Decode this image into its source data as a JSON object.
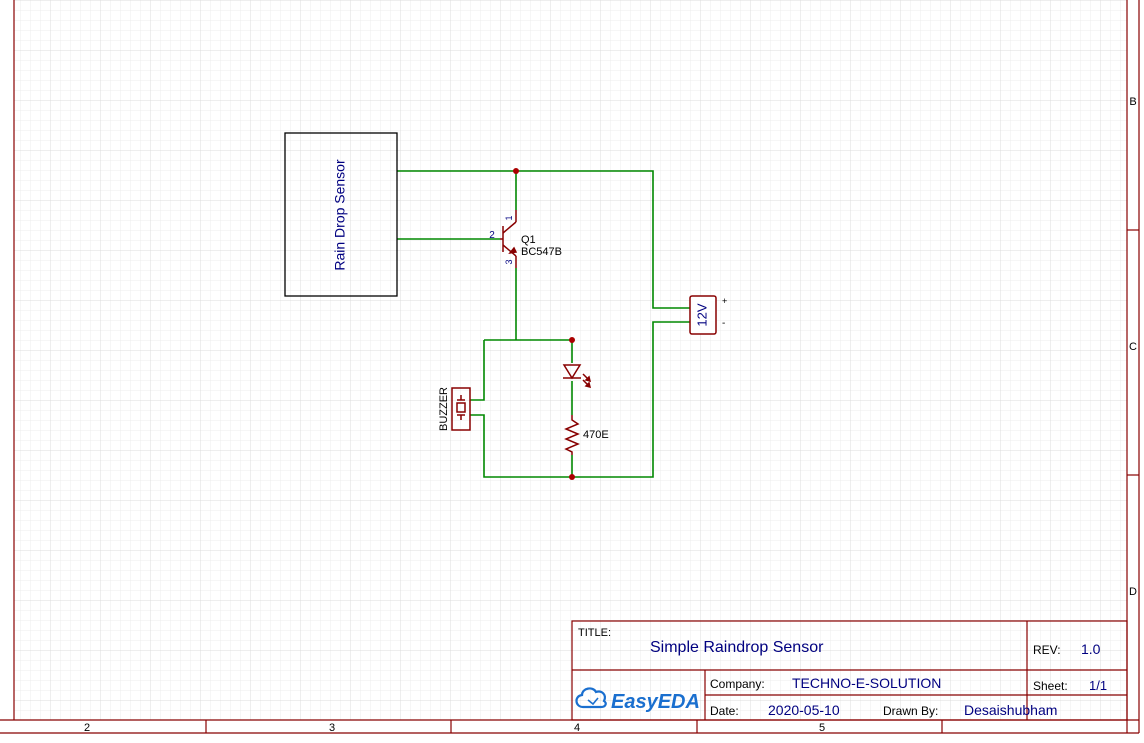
{
  "border": {
    "rows": [
      "B",
      "C",
      "D"
    ],
    "columns": [
      "2",
      "3",
      "4",
      "5"
    ]
  },
  "components": {
    "sensor": {
      "label": "Rain Drop Sensor"
    },
    "transistor": {
      "ref": "Q1",
      "value": "BC547B",
      "pins": {
        "collector": "1",
        "base": "2",
        "emitter": "3"
      }
    },
    "supply": {
      "label": "12V",
      "plus": "+",
      "minus": "-"
    },
    "buzzer": {
      "label": "BUZZER"
    },
    "resistor": {
      "value": "470E"
    }
  },
  "title_block": {
    "title_label": "TITLE:",
    "title": "Simple Raindrop Sensor",
    "rev_label": "REV:",
    "rev": "1.0",
    "logo_text": "EasyEDA",
    "company_label": "Company:",
    "company": "TECHNO-E-SOLUTION",
    "sheet_label": "Sheet:",
    "sheet": "1/1",
    "date_label": "Date:",
    "date": "2020-05-10",
    "drawn_by_label": "Drawn By:",
    "drawn_by": "Desaishubham"
  },
  "colors": {
    "wire": "#008800",
    "component": "#880000",
    "text": "#000080",
    "frame": "#880000",
    "grid": "#e6e6e6",
    "logo": "#1a6fcf"
  }
}
